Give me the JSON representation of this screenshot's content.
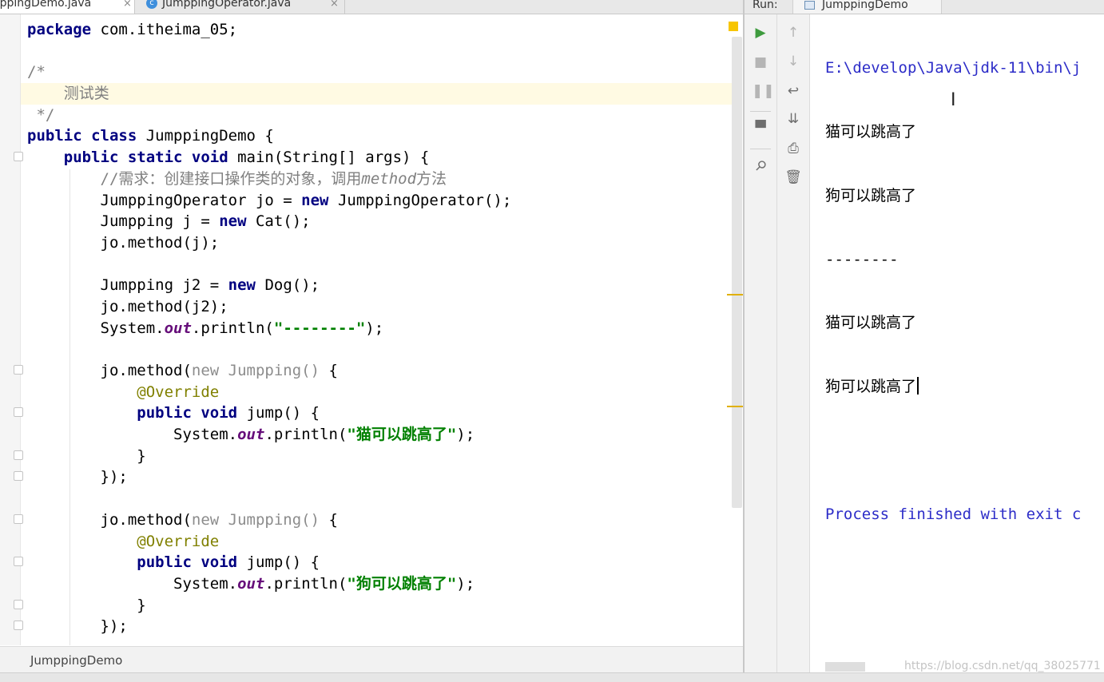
{
  "editor": {
    "tabs": [
      {
        "label": "mppingDemo.java",
        "close": "×",
        "active": true
      },
      {
        "label": "JumppingOperator.java",
        "close": "×",
        "active": false,
        "icon_letter": "c"
      }
    ],
    "code_lines": [
      [
        {
          "t": "package",
          "c": "kw"
        },
        {
          "t": " com.itheima_05;"
        }
      ],
      [],
      [
        {
          "t": "/*",
          "c": "cm"
        }
      ],
      [
        {
          "t": "    测试类",
          "c": "cm"
        }
      ],
      [
        {
          "t": " */",
          "c": "cm"
        }
      ],
      [
        {
          "t": "public class",
          "c": "kw"
        },
        {
          "t": " JumppingDemo {"
        }
      ],
      [
        {
          "t": "    "
        },
        {
          "t": "public static void",
          "c": "kw"
        },
        {
          "t": " main(String[] args) {"
        }
      ],
      [
        {
          "t": "        "
        },
        {
          "t": "//需求：创建接口操作类的对象，调用",
          "c": "cm"
        },
        {
          "t": "method",
          "c": "cmi"
        },
        {
          "t": "方法",
          "c": "cm"
        }
      ],
      [
        {
          "t": "        JumppingOperator jo = "
        },
        {
          "t": "new",
          "c": "kw"
        },
        {
          "t": " JumppingOperator();"
        }
      ],
      [
        {
          "t": "        Jumpping j = "
        },
        {
          "t": "new",
          "c": "kw"
        },
        {
          "t": " Cat();"
        }
      ],
      [
        {
          "t": "        jo.method(j);"
        }
      ],
      [],
      [
        {
          "t": "        Jumpping j2 = "
        },
        {
          "t": "new",
          "c": "kw"
        },
        {
          "t": " Dog();"
        }
      ],
      [
        {
          "t": "        jo.method(j2);"
        }
      ],
      [
        {
          "t": "        System."
        },
        {
          "t": "out",
          "c": "fld"
        },
        {
          "t": ".println("
        },
        {
          "t": "\"--------\"",
          "c": "str"
        },
        {
          "t": ");"
        }
      ],
      [],
      [
        {
          "t": "        jo.method("
        },
        {
          "t": "new Jumpping() ",
          "c": "dim"
        },
        {
          "t": "{"
        }
      ],
      [
        {
          "t": "            "
        },
        {
          "t": "@Override",
          "c": "ann"
        }
      ],
      [
        {
          "t": "            "
        },
        {
          "t": "public void",
          "c": "kw"
        },
        {
          "t": " jump() {"
        }
      ],
      [
        {
          "t": "                System."
        },
        {
          "t": "out",
          "c": "fld"
        },
        {
          "t": ".println("
        },
        {
          "t": "\"猫可以跳高了\"",
          "c": "str"
        },
        {
          "t": ");"
        }
      ],
      [
        {
          "t": "            }"
        }
      ],
      [
        {
          "t": "        });"
        }
      ],
      [],
      [
        {
          "t": "        jo.method("
        },
        {
          "t": "new Jumpping() ",
          "c": "dim"
        },
        {
          "t": "{"
        }
      ],
      [
        {
          "t": "            "
        },
        {
          "t": "@Override",
          "c": "ann"
        }
      ],
      [
        {
          "t": "            "
        },
        {
          "t": "public void",
          "c": "kw"
        },
        {
          "t": " jump() {"
        }
      ],
      [
        {
          "t": "                System."
        },
        {
          "t": "out",
          "c": "fld"
        },
        {
          "t": ".println("
        },
        {
          "t": "\"狗可以跳高了\"",
          "c": "str"
        },
        {
          "t": ");"
        }
      ],
      [
        {
          "t": "            }"
        }
      ],
      [
        {
          "t": "        });"
        }
      ]
    ],
    "breadcrumb": "JumppingDemo"
  },
  "run_panel": {
    "label": "Run:",
    "tab_label": "JumppingDemo",
    "left_toolbar": [
      "run-icon",
      "stop-icon",
      "pause-icon",
      "layout-icon",
      "pin-icon"
    ],
    "right_toolbar": [
      "up-arrow-icon",
      "down-arrow-icon",
      "soft-wrap-icon",
      "scroll-to-end-icon",
      "print-icon",
      "trash-icon"
    ],
    "console_lines": [
      "E:\\develop\\Java\\jdk-11\\bin\\j",
      "猫可以跳高了",
      "狗可以跳高了",
      "--------",
      "猫可以跳高了",
      "狗可以跳高了",
      "",
      "Process finished with exit c"
    ],
    "watermark": "https://blog.csdn.net/qq_38025771"
  },
  "colors": {
    "keyword": "#000080",
    "comment": "#808080",
    "string": "#008000",
    "annotation": "#808000",
    "static_field": "#660e7a",
    "console_link": "#2d2dc8",
    "run_green": "#3e9b3e"
  }
}
